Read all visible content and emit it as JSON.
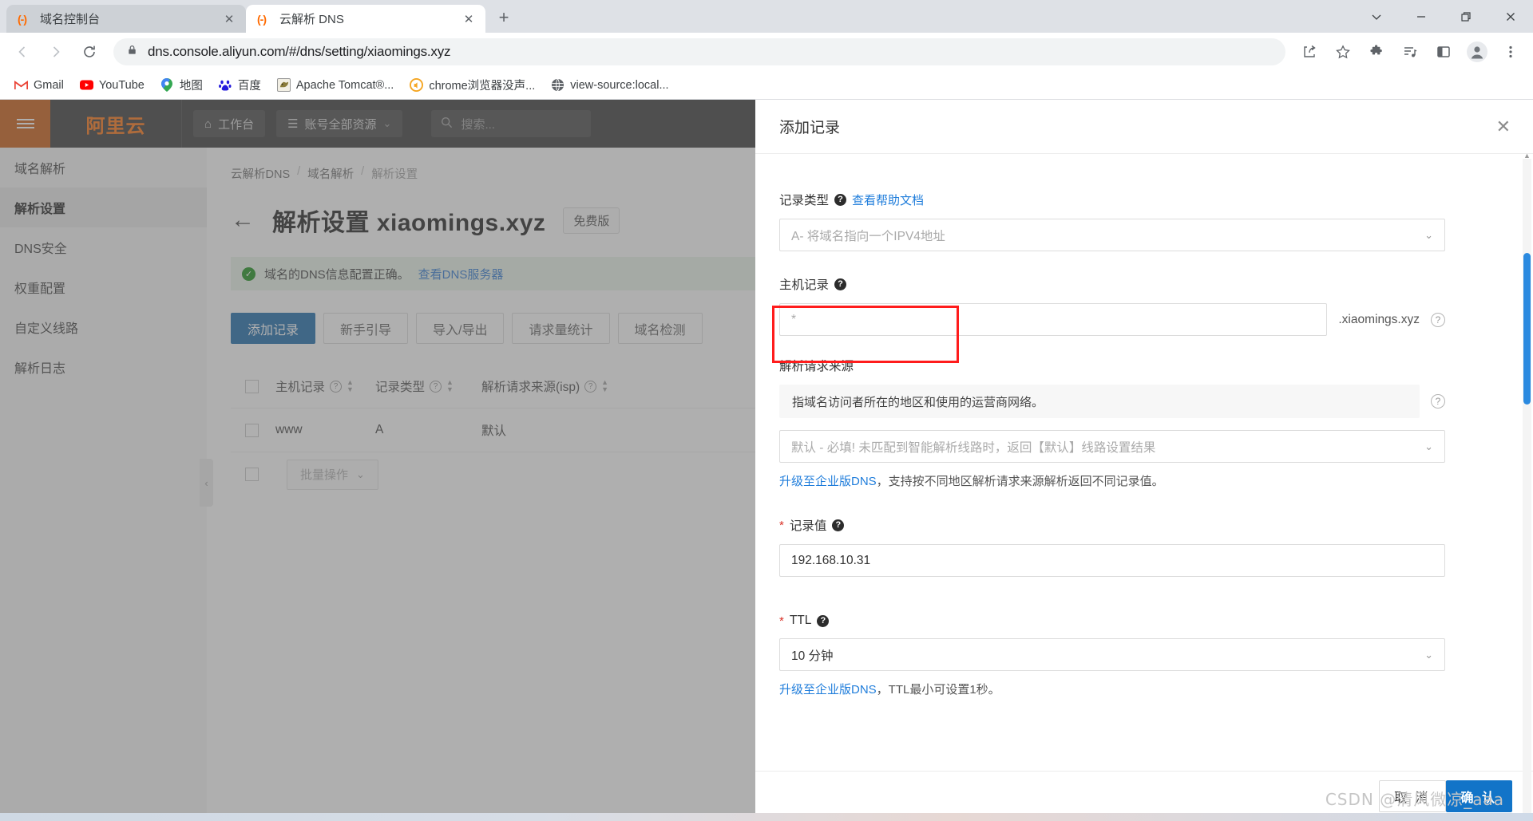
{
  "browser": {
    "tabs": [
      {
        "title": "域名控制台",
        "favicon": "aliyun-icon",
        "active": false
      },
      {
        "title": "云解析 DNS",
        "favicon": "aliyun-icon",
        "active": true
      }
    ],
    "new_tab_label": "+",
    "window_controls": {
      "more": "chevron-down-icon",
      "minimize": "minimize-icon",
      "restore": "restore-icon",
      "close": "close-icon"
    },
    "toolbar": {
      "back": "back-arrow-icon",
      "forward": "forward-arrow-icon",
      "reload": "reload-icon",
      "lock": "lock-icon",
      "url": "dns.console.aliyun.com/#/dns/setting/xiaomings.xyz",
      "share": "share-icon",
      "bookmark": "star-icon",
      "extensions": "puzzle-icon",
      "reading_list": "reading-list-icon",
      "side_panel": "side-panel-icon",
      "profile": "profile-avatar-icon",
      "menu": "three-dot-menu-icon"
    },
    "bookmarks": [
      {
        "label": "Gmail",
        "icon": "gmail-icon",
        "color": "#ea4335",
        "glyph": "M"
      },
      {
        "label": "YouTube",
        "icon": "youtube-icon",
        "color": "#ff0000",
        "glyph": "▶"
      },
      {
        "label": "地图",
        "icon": "maps-icon",
        "color": "#1a73e8",
        "glyph": "◉"
      },
      {
        "label": "百度",
        "icon": "baidu-icon",
        "color": "#2319dc",
        "glyph": "熊"
      },
      {
        "label": "Apache Tomcat®...",
        "icon": "tomcat-icon",
        "color": "#7a7a3a",
        "glyph": "🐱"
      },
      {
        "label": "chrome浏览器没声...",
        "icon": "chrome-sound-icon",
        "color": "#f5a623",
        "glyph": "◑"
      },
      {
        "label": "view-source:local...",
        "icon": "globe-icon",
        "color": "#5f6368",
        "glyph": "🌐"
      }
    ]
  },
  "console_header": {
    "menu_icon": "hamburger-menu-icon",
    "logo": "阿里云",
    "workbench": {
      "label": "工作台",
      "icon": "home-icon"
    },
    "resources": {
      "label": "账号全部资源",
      "icon": "resource-icon",
      "chevron": "⌄"
    },
    "search_placeholder": "搜索..."
  },
  "sidebar": {
    "title": "域名解析",
    "items": [
      {
        "label": "解析设置",
        "active": true
      },
      {
        "label": "DNS安全",
        "active": false
      },
      {
        "label": "权重配置",
        "active": false
      },
      {
        "label": "自定义线路",
        "active": false
      },
      {
        "label": "解析日志",
        "active": false
      }
    ]
  },
  "main": {
    "breadcrumb": [
      "云解析DNS",
      "域名解析",
      "解析设置"
    ],
    "back_icon": "back-arrow-icon",
    "page_title": "解析设置 xiaomings.xyz",
    "edition_badge": "免费版",
    "alert": {
      "icon": "check-circle-icon",
      "text": "域名的DNS信息配置正确。",
      "link": "查看DNS服务器"
    },
    "ops": [
      {
        "label": "添加记录",
        "primary": true
      },
      {
        "label": "新手引导",
        "primary": false
      },
      {
        "label": "导入/导出",
        "primary": false
      },
      {
        "label": "请求量统计",
        "primary": false
      },
      {
        "label": "域名检测",
        "primary": false
      }
    ],
    "table": {
      "columns": [
        "主机记录",
        "记录类型",
        "解析请求来源(isp)"
      ],
      "rows": [
        {
          "host": "www",
          "type": "A",
          "line": "默认"
        }
      ],
      "bulk_label": "批量操作",
      "bulk_chevron": "⌄"
    },
    "collapse_handle": "‹"
  },
  "drawer": {
    "title": "添加记录",
    "close_icon": "close-icon",
    "fields": {
      "record_type": {
        "label": "记录类型",
        "help_link": "查看帮助文档",
        "value": "A- 将域名指向一个IPV4地址",
        "chevron": "⌄"
      },
      "host_record": {
        "label": "主机记录",
        "value": "*",
        "suffix": ".xiaomings.xyz",
        "annotated": true,
        "annotation_color": "#ff1c1c"
      },
      "request_source": {
        "label": "解析请求来源",
        "note": "指域名访问者所在的地区和使用的运营商网络。",
        "value": "默认 - 必填! 未匹配到智能解析线路时，返回【默认】线路设置结果",
        "chevron": "⌄",
        "hint_link": "升级至企业版DNS",
        "hint_rest": "，支持按不同地区解析请求来源解析返回不同记录值。"
      },
      "record_value": {
        "label": "记录值",
        "required": true,
        "value": "192.168.10.31"
      },
      "ttl": {
        "label": "TTL",
        "required": true,
        "value": "10 分钟",
        "chevron": "⌄",
        "hint_link": "升级至企业版DNS",
        "hint_rest": "，TTL最小可设置1秒。"
      }
    },
    "footer": {
      "cancel": "取 消",
      "confirm": "确 认"
    }
  },
  "watermark": "CSDN @清风微凉_aaa"
}
